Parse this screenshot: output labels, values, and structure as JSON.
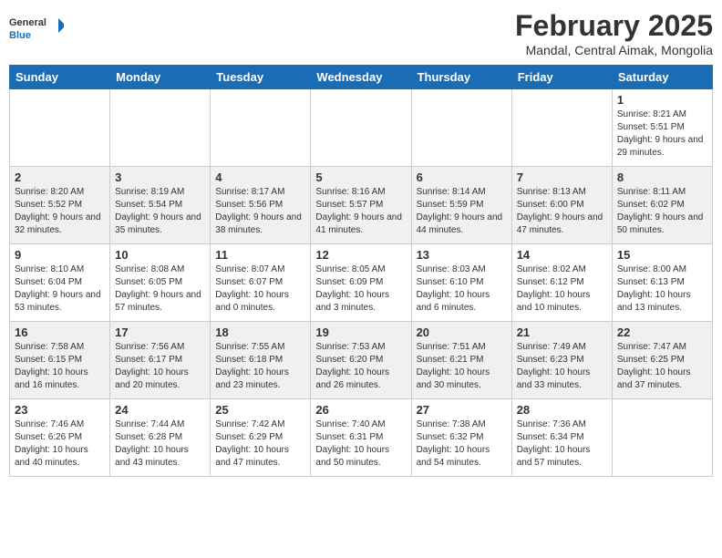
{
  "header": {
    "logo_general": "General",
    "logo_blue": "Blue",
    "month_title": "February 2025",
    "subtitle": "Mandal, Central Aimak, Mongolia"
  },
  "days_of_week": [
    "Sunday",
    "Monday",
    "Tuesday",
    "Wednesday",
    "Thursday",
    "Friday",
    "Saturday"
  ],
  "weeks": [
    [
      {
        "day": "",
        "info": ""
      },
      {
        "day": "",
        "info": ""
      },
      {
        "day": "",
        "info": ""
      },
      {
        "day": "",
        "info": ""
      },
      {
        "day": "",
        "info": ""
      },
      {
        "day": "",
        "info": ""
      },
      {
        "day": "1",
        "info": "Sunrise: 8:21 AM\nSunset: 5:51 PM\nDaylight: 9 hours and 29 minutes."
      }
    ],
    [
      {
        "day": "2",
        "info": "Sunrise: 8:20 AM\nSunset: 5:52 PM\nDaylight: 9 hours and 32 minutes."
      },
      {
        "day": "3",
        "info": "Sunrise: 8:19 AM\nSunset: 5:54 PM\nDaylight: 9 hours and 35 minutes."
      },
      {
        "day": "4",
        "info": "Sunrise: 8:17 AM\nSunset: 5:56 PM\nDaylight: 9 hours and 38 minutes."
      },
      {
        "day": "5",
        "info": "Sunrise: 8:16 AM\nSunset: 5:57 PM\nDaylight: 9 hours and 41 minutes."
      },
      {
        "day": "6",
        "info": "Sunrise: 8:14 AM\nSunset: 5:59 PM\nDaylight: 9 hours and 44 minutes."
      },
      {
        "day": "7",
        "info": "Sunrise: 8:13 AM\nSunset: 6:00 PM\nDaylight: 9 hours and 47 minutes."
      },
      {
        "day": "8",
        "info": "Sunrise: 8:11 AM\nSunset: 6:02 PM\nDaylight: 9 hours and 50 minutes."
      }
    ],
    [
      {
        "day": "9",
        "info": "Sunrise: 8:10 AM\nSunset: 6:04 PM\nDaylight: 9 hours and 53 minutes."
      },
      {
        "day": "10",
        "info": "Sunrise: 8:08 AM\nSunset: 6:05 PM\nDaylight: 9 hours and 57 minutes."
      },
      {
        "day": "11",
        "info": "Sunrise: 8:07 AM\nSunset: 6:07 PM\nDaylight: 10 hours and 0 minutes."
      },
      {
        "day": "12",
        "info": "Sunrise: 8:05 AM\nSunset: 6:09 PM\nDaylight: 10 hours and 3 minutes."
      },
      {
        "day": "13",
        "info": "Sunrise: 8:03 AM\nSunset: 6:10 PM\nDaylight: 10 hours and 6 minutes."
      },
      {
        "day": "14",
        "info": "Sunrise: 8:02 AM\nSunset: 6:12 PM\nDaylight: 10 hours and 10 minutes."
      },
      {
        "day": "15",
        "info": "Sunrise: 8:00 AM\nSunset: 6:13 PM\nDaylight: 10 hours and 13 minutes."
      }
    ],
    [
      {
        "day": "16",
        "info": "Sunrise: 7:58 AM\nSunset: 6:15 PM\nDaylight: 10 hours and 16 minutes."
      },
      {
        "day": "17",
        "info": "Sunrise: 7:56 AM\nSunset: 6:17 PM\nDaylight: 10 hours and 20 minutes."
      },
      {
        "day": "18",
        "info": "Sunrise: 7:55 AM\nSunset: 6:18 PM\nDaylight: 10 hours and 23 minutes."
      },
      {
        "day": "19",
        "info": "Sunrise: 7:53 AM\nSunset: 6:20 PM\nDaylight: 10 hours and 26 minutes."
      },
      {
        "day": "20",
        "info": "Sunrise: 7:51 AM\nSunset: 6:21 PM\nDaylight: 10 hours and 30 minutes."
      },
      {
        "day": "21",
        "info": "Sunrise: 7:49 AM\nSunset: 6:23 PM\nDaylight: 10 hours and 33 minutes."
      },
      {
        "day": "22",
        "info": "Sunrise: 7:47 AM\nSunset: 6:25 PM\nDaylight: 10 hours and 37 minutes."
      }
    ],
    [
      {
        "day": "23",
        "info": "Sunrise: 7:46 AM\nSunset: 6:26 PM\nDaylight: 10 hours and 40 minutes."
      },
      {
        "day": "24",
        "info": "Sunrise: 7:44 AM\nSunset: 6:28 PM\nDaylight: 10 hours and 43 minutes."
      },
      {
        "day": "25",
        "info": "Sunrise: 7:42 AM\nSunset: 6:29 PM\nDaylight: 10 hours and 47 minutes."
      },
      {
        "day": "26",
        "info": "Sunrise: 7:40 AM\nSunset: 6:31 PM\nDaylight: 10 hours and 50 minutes."
      },
      {
        "day": "27",
        "info": "Sunrise: 7:38 AM\nSunset: 6:32 PM\nDaylight: 10 hours and 54 minutes."
      },
      {
        "day": "28",
        "info": "Sunrise: 7:36 AM\nSunset: 6:34 PM\nDaylight: 10 hours and 57 minutes."
      },
      {
        "day": "",
        "info": ""
      }
    ]
  ]
}
